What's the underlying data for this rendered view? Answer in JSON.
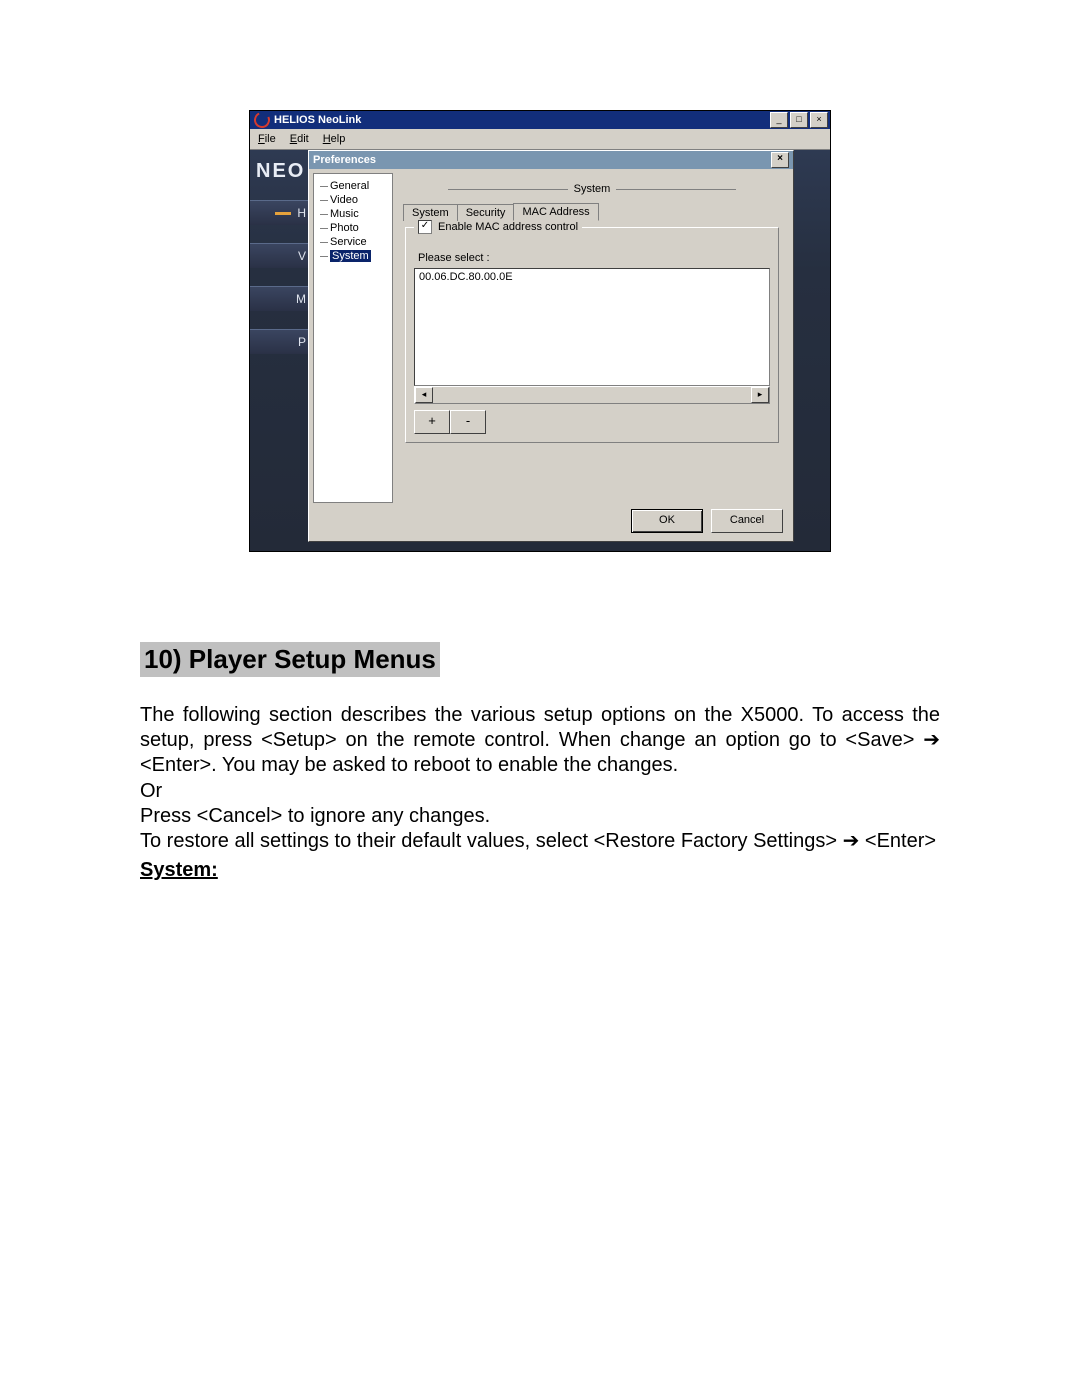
{
  "screenshot": {
    "window": {
      "title": "HELIOS NeoLink",
      "menus": {
        "file": "File",
        "edit": "Edit",
        "help": "Help"
      },
      "win_buttons": {
        "min": "_",
        "max": "□",
        "close": "×"
      }
    },
    "app": {
      "brand": "NEO",
      "left_tabs": [
        "H",
        "V",
        "M",
        "P"
      ]
    },
    "preferences": {
      "title": "Preferences",
      "close": "×",
      "tree": [
        "General",
        "Video",
        "Music",
        "Photo",
        "Service",
        "System"
      ],
      "tree_selected": "System",
      "panel_title": "System",
      "tabs": [
        "System",
        "Security",
        "MAC Address"
      ],
      "active_tab": "MAC Address",
      "checkbox_label": "Enable MAC address control",
      "checkbox_checked": true,
      "please_select": "Please select :",
      "list_entries": [
        "00.06.DC.80.00.0E"
      ],
      "buttons": {
        "plus": "+",
        "minus": "-",
        "ok": "OK",
        "cancel": "Cancel"
      }
    }
  },
  "doc": {
    "heading": "10) Player Setup Menus",
    "p1a": "The following section describes the various setup options on the X5000. To access the setup, press <Setup> on the remote control. When change an option go to <Save> ",
    "arrow": "➔",
    "p1b": " <Enter>. You may be asked to reboot to enable the changes.",
    "or": "Or",
    "p2": "Press <Cancel> to ignore any changes.",
    "p3a": "To restore all settings to their default values, select <Restore Factory Settings> ",
    "p3b": " <Enter>",
    "sub": "System:"
  }
}
